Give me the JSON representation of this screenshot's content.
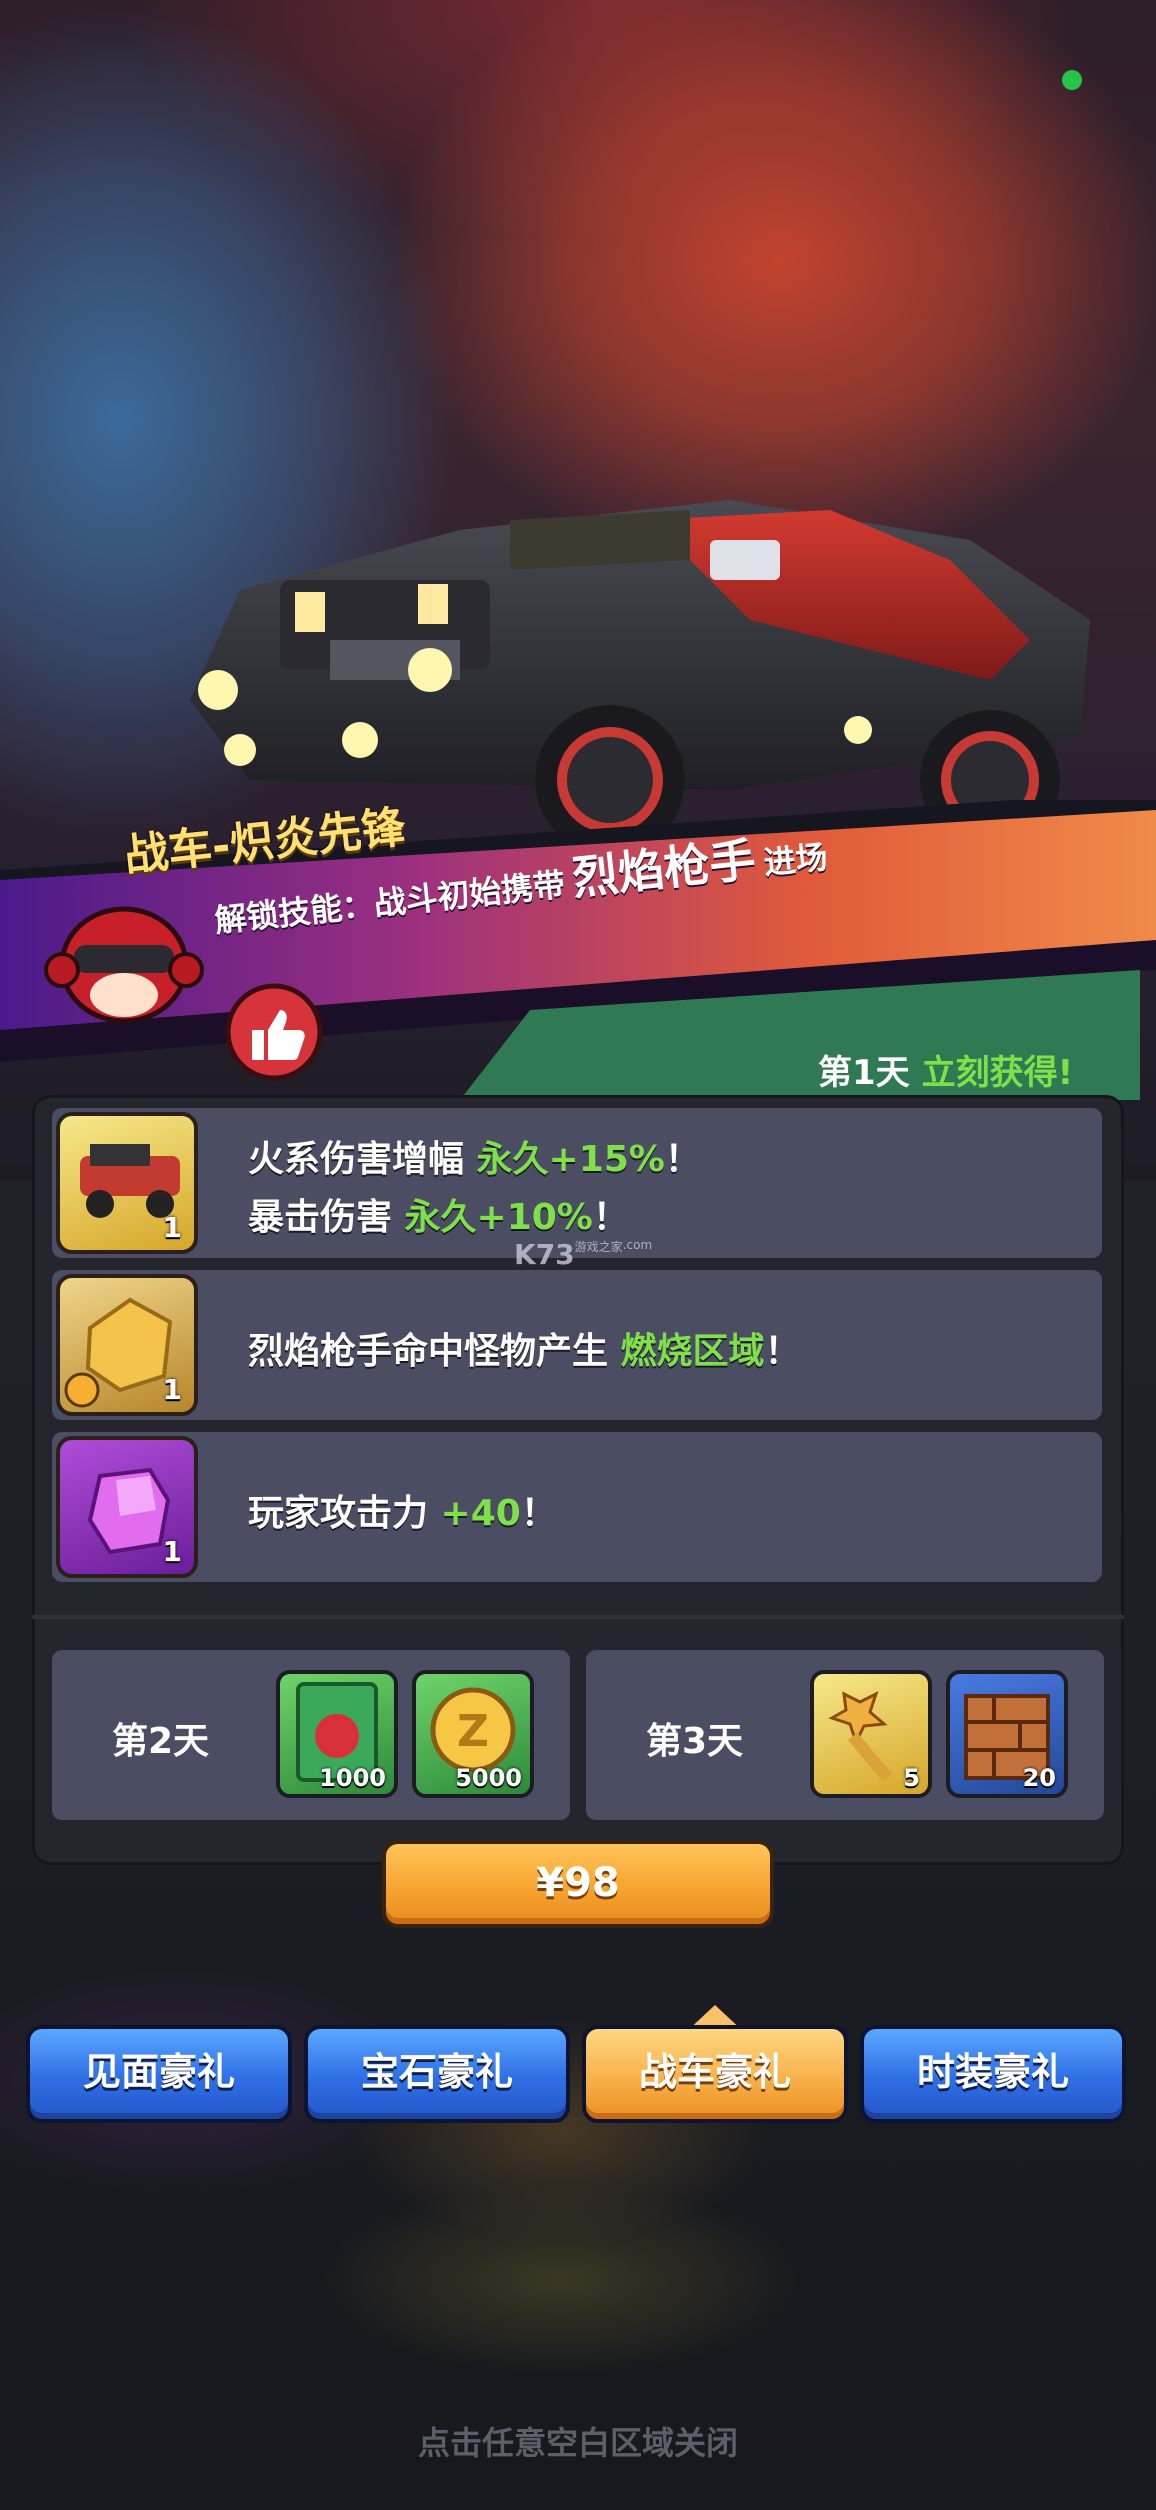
{
  "banner": {
    "vehicle_title": "战车-炽炎先锋",
    "skill_label": "解锁技能：战斗初始携带",
    "skill_name": "烈焰枪手",
    "skill_suffix": "进场"
  },
  "day1": {
    "day": "第1天",
    "claim": "立刻获得!"
  },
  "rewards": [
    {
      "icon": "vehicle-icon",
      "qty": "1",
      "line1_prefix": "火系伤害增幅 ",
      "line1_hl": "永久+15%",
      "line1_suffix": "！",
      "line2_prefix": "暴击伤害 ",
      "line2_hl": "永久+10%",
      "line2_suffix": "！"
    },
    {
      "icon": "gold-ore-icon",
      "qty": "1",
      "line1_prefix": "烈焰枪手命中怪物产生 ",
      "line1_hl": "燃烧区域",
      "line1_suffix": "！"
    },
    {
      "icon": "purple-crystal-icon",
      "qty": "1",
      "line1_prefix": "玩家攻击力 ",
      "line1_hl": "+40",
      "line1_suffix": "！"
    }
  ],
  "watermark": {
    "main": "K73",
    "sub1": "游戏之家",
    "sub2": ".com"
  },
  "day2": {
    "label": "第2天",
    "items": [
      {
        "icon": "exp-card-icon",
        "amount": "1000"
      },
      {
        "icon": "gold-coin-icon",
        "amount": "5000"
      }
    ]
  },
  "day3": {
    "label": "第3天",
    "items": [
      {
        "icon": "golden-key-icon",
        "amount": "5"
      },
      {
        "icon": "brick-block-icon",
        "amount": "20"
      }
    ]
  },
  "price": "¥98",
  "tabs": [
    {
      "label": "见面豪礼",
      "active": false
    },
    {
      "label": "宝石豪礼",
      "active": false
    },
    {
      "label": "战车豪礼",
      "active": true
    },
    {
      "label": "时装豪礼",
      "active": false
    }
  ],
  "close_hint": "点击任意空白区域关闭",
  "colors": {
    "highlight": "#7fe04a",
    "tab_blue": "#2f6fe6",
    "tab_orange": "#f8b14a",
    "row_bg": "#4b4d62"
  }
}
